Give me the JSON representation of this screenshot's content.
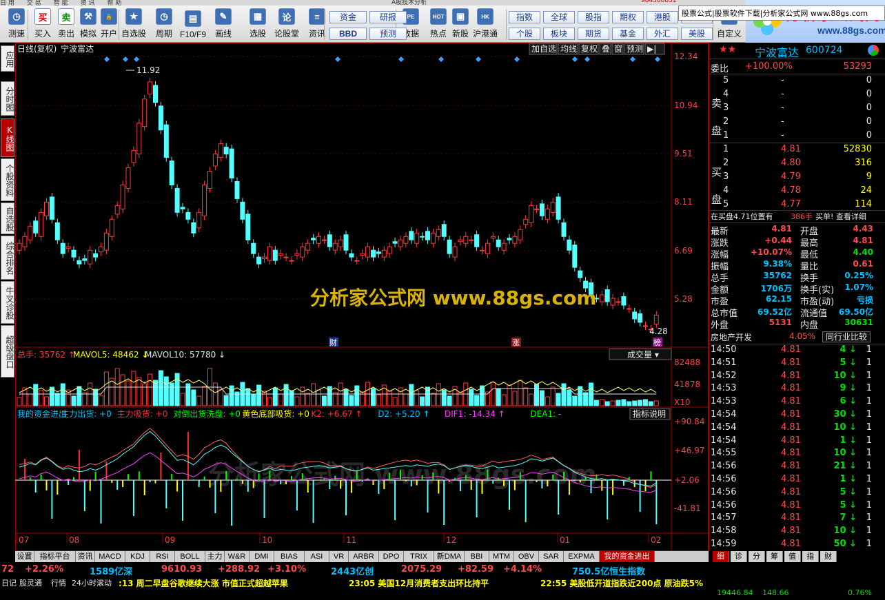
{
  "menu": [
    "日 用",
    "交 易",
    "智 能",
    "资 讯",
    "帮 助",
    "A股技术分析",
    "984388831"
  ],
  "toolbar": {
    "buttons": [
      {
        "id": "zhenduan",
        "label": "测速",
        "glyph": "◷"
      },
      {
        "id": "buy",
        "label": "买入",
        "glyph": "买"
      },
      {
        "id": "sell",
        "label": "卖出",
        "glyph": "卖"
      },
      {
        "id": "simulate",
        "label": "模拟",
        "glyph": "⚒"
      },
      {
        "id": "open",
        "label": "开户",
        "glyph": "🔒"
      },
      {
        "id": "watchlist",
        "label": "自选股",
        "glyph": "★"
      },
      {
        "id": "period",
        "label": "周期",
        "glyph": "◷"
      },
      {
        "id": "f10",
        "label": "F10/F9",
        "glyph": "▤"
      },
      {
        "id": "draw",
        "label": "画线",
        "glyph": "✎"
      },
      {
        "id": "pick",
        "label": "选股",
        "glyph": "▦"
      },
      {
        "id": "forum",
        "label": "论股堂",
        "glyph": "论"
      },
      {
        "id": "news",
        "label": "资讯",
        "glyph": "≡"
      },
      {
        "id": "data",
        "label": "数据",
        "glyph": "PE"
      },
      {
        "id": "hot",
        "label": "热点",
        "glyph": "HOT"
      },
      {
        "id": "newstock",
        "label": "新股",
        "glyph": "▣"
      },
      {
        "id": "hkconnect",
        "label": "沪港通",
        "glyph": "HK"
      },
      {
        "id": "custom",
        "label": "自定义",
        "glyph": "✎"
      }
    ],
    "small": [
      {
        "id": "zijin",
        "label": "资金"
      },
      {
        "id": "yanbao",
        "label": "研报"
      },
      {
        "id": "bbd",
        "label": "BBD"
      },
      {
        "id": "yuce",
        "label": "预测"
      },
      {
        "id": "zhishu",
        "label": "指数"
      },
      {
        "id": "quanqiu",
        "label": "全球"
      },
      {
        "id": "guzhi",
        "label": "股指"
      },
      {
        "id": "qiquan",
        "label": "期权"
      },
      {
        "id": "ganggu",
        "label": "港股"
      },
      {
        "id": "zhaiquan",
        "label": "债券"
      },
      {
        "id": "gegu",
        "label": "个股"
      },
      {
        "id": "bankuai",
        "label": "板块"
      },
      {
        "id": "qihuo",
        "label": "期货"
      },
      {
        "id": "jijin",
        "label": "基金"
      },
      {
        "id": "waihui",
        "label": "外汇"
      },
      {
        "id": "meigu",
        "label": "美股"
      }
    ]
  },
  "logo": {
    "name": "分析家公式网",
    "url": "www.88gs.com"
  },
  "left_tabs": [
    {
      "label": "应用"
    },
    {
      "label": "分时图"
    },
    {
      "label": "K线图"
    },
    {
      "label": "个股资料"
    },
    {
      "label": "自选股"
    },
    {
      "label": "综合排名"
    },
    {
      "label": "牛叉诊股"
    },
    {
      "label": "超级盘口"
    }
  ],
  "chart": {
    "title": "日线(复权)",
    "stock": "宁波富达",
    "tools": [
      "加自选",
      "均线",
      "复权",
      "叠",
      "窗",
      "预测",
      "▶|"
    ],
    "price_ticks": [
      "12.34",
      "10.94",
      "9.51",
      "8.11",
      "6.69",
      "5.28"
    ],
    "high_label": "11.92",
    "low_label": "4.28",
    "watermark": "分析家公式网 www.88gs.com",
    "watermark2": "分析家公式网 www.88gs.com",
    "markers": [
      "财",
      "涨",
      "榜"
    ],
    "vol_legend": {
      "total": "总手: 35762",
      "ma5": "MAVOL5: 48462",
      "ma10": "MAVOL10: 57780"
    },
    "vol_dropdown": "成交量",
    "vol_ticks": [
      "82488",
      "41878",
      "X10"
    ],
    "ind_legend": [
      {
        "t": "我的资金进出",
        "c": "#00c0ff"
      },
      {
        "t": "主力出货: +0",
        "c": "#00c0ff"
      },
      {
        "t": "主力吸货: +0",
        "c": "#ff3030"
      },
      {
        "t": "对倒出货洗盘: +0",
        "c": "#00ff00"
      },
      {
        "t": "黄色底部吸货: +0",
        "c": "#ffff00"
      },
      {
        "t": "K2: +6.67",
        "c": "#ff3030"
      },
      {
        "t": "D2: +5.20",
        "c": "#00c0ff"
      },
      {
        "t": "DIF1: -14.34",
        "c": "#ff40ff"
      },
      {
        "t": "DEA1: -",
        "c": "#00ff00"
      }
    ],
    "ind_button": "指标说明",
    "ind_ticks": [
      "+90.84",
      "+46.97",
      "+2.06",
      "-41.81"
    ],
    "months": [
      "07",
      "08",
      "09",
      "10",
      "11",
      "12",
      "01",
      "02"
    ]
  },
  "quote": {
    "name": "宁波富达",
    "code": "600724",
    "weibi_label": "委比",
    "weibi": "+100.00%",
    "weicha": "53293",
    "sell_label": [
      "卖",
      "盘"
    ],
    "buy_label": [
      "买",
      "盘"
    ],
    "asks": [
      {
        "n": "5",
        "p": "-",
        "v": "0"
      },
      {
        "n": "4",
        "p": "-",
        "v": "0"
      },
      {
        "n": "3",
        "p": "-",
        "v": "0"
      },
      {
        "n": "2",
        "p": "-",
        "v": "0"
      },
      {
        "n": "1",
        "p": "-",
        "v": "0"
      }
    ],
    "bids": [
      {
        "n": "1",
        "p": "4.81",
        "v": "52830"
      },
      {
        "n": "2",
        "p": "4.80",
        "v": "316"
      },
      {
        "n": "3",
        "p": "4.79",
        "v": "9"
      },
      {
        "n": "4",
        "p": "4.78",
        "v": "24"
      },
      {
        "n": "5",
        "p": "4.77",
        "v": "114"
      }
    ],
    "info_text": "在买盘4.71位置有",
    "info_hands": "386手",
    "info_link": "买单! 查看详细",
    "stats": [
      [
        "最新",
        "4.81",
        "开盘",
        "4.43"
      ],
      [
        "涨跌",
        "+0.44",
        "最高",
        "4.81"
      ],
      [
        "涨幅",
        "+10.07%",
        "最低",
        "4.40"
      ],
      [
        "振幅",
        "9.38%",
        "量比",
        "0.61"
      ],
      [
        "总手",
        "35762",
        "换手",
        "0.25%"
      ],
      [
        "金额",
        "1706万",
        "换手(实)",
        "1.07%"
      ],
      [
        "市盈",
        "62.15",
        "市盈(动)",
        "亏损"
      ],
      [
        "总市值",
        "69.52亿",
        "流通值",
        "69.50亿"
      ],
      [
        "外盘",
        "5131",
        "内盘",
        "30631"
      ]
    ],
    "industry": "房地产开发",
    "industry_pct": "4.05%",
    "industry_btn": "同行业比较",
    "ticks": [
      [
        "14:50",
        "4.81",
        "4"
      ],
      [
        "14:51",
        "4.81",
        "5"
      ],
      [
        "14:52",
        "4.81",
        "10"
      ],
      [
        "14:53",
        "4.81",
        "9"
      ],
      [
        "14:53",
        "4.81",
        "6"
      ],
      [
        "14:54",
        "4.81",
        "30"
      ],
      [
        "14:54",
        "4.81",
        "10"
      ],
      [
        "14:54",
        "4.81",
        "1"
      ],
      [
        "14:55",
        "4.81",
        "10"
      ],
      [
        "14:56",
        "4.81",
        "21"
      ],
      [
        "14:56",
        "4.81",
        "1"
      ],
      [
        "14:56",
        "4.81",
        "5"
      ],
      [
        "14:56",
        "4.81",
        "5"
      ],
      [
        "14:57",
        "4.81",
        "7"
      ],
      [
        "14:58",
        "4.81",
        "10"
      ],
      [
        "14:59",
        "4.81",
        "50"
      ]
    ],
    "tick_right": "1"
  },
  "bottom_tabs": [
    "设置",
    "指标平台",
    "资讯",
    "MACD",
    "KDJ",
    "RSI",
    "BOLL",
    "主力",
    "W&R",
    "DMI",
    "BIAS",
    "ASI",
    "VR",
    "ARBR",
    "DPO",
    "TRIX",
    "新DMA",
    "BBI",
    "MTM",
    "OBV",
    "SAR",
    "EXPMA",
    "我的资金进出"
  ],
  "right_bottom_tabs": [
    "细",
    "诊",
    "分",
    "筹",
    "值",
    "指",
    "财"
  ],
  "ticker": [
    {
      "t": "72",
      "c": "#ff4a4a"
    },
    {
      "t": "+2.26%",
      "c": "#ff4a4a"
    },
    {
      "t": "1589亿深",
      "c": "#00c0ff"
    },
    {
      "t": "9610.93",
      "c": "#ff4a4a"
    },
    {
      "t": "+288.92",
      "c": "#ff4a4a"
    },
    {
      "t": "+3.10%",
      "c": "#ff4a4a"
    },
    {
      "t": "2443亿创",
      "c": "#00c0ff"
    },
    {
      "t": "2075.29",
      "c": "#ff4a4a"
    },
    {
      "t": "+82.59",
      "c": "#ff4a4a"
    },
    {
      "t": "+4.14%",
      "c": "#ff4a4a"
    },
    {
      "t": "750.5亿恒生指数",
      "c": "#00c0ff"
    }
  ],
  "popup": "股票公式|股票软件下载|分析家公式网 www.88gs.com",
  "news": {
    "tabs": [
      "日记",
      "股灵通",
      "行情",
      "24小时滚动"
    ],
    "items": [
      ":13 周二早盘谷歌继续大涨 市值正式超越苹果",
      "23:05 美国12月消费者支出环比持平",
      "22:55 美股低开道指跌近200点 原油跌5%"
    ]
  },
  "status": [
    "19446.84",
    "148.66",
    "0.76%"
  ]
}
